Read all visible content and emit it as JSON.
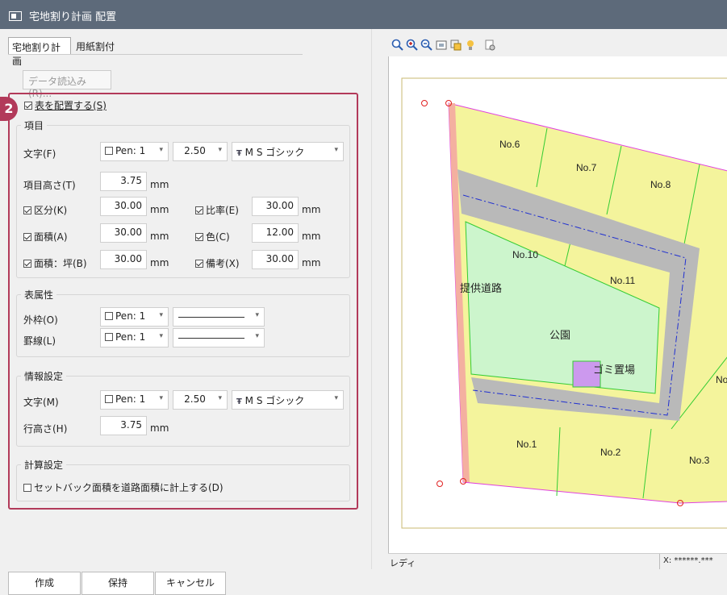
{
  "window": {
    "title": "宅地割り計画 配置"
  },
  "tabs": [
    {
      "label": "宅地割り計画"
    },
    {
      "label": "用紙割付"
    }
  ],
  "data_button": "データ読込み(R)...",
  "step_badge": "2",
  "place_table": {
    "label": "表を配置する(S)",
    "checked": true
  },
  "items_group": {
    "title": "項目",
    "text_label": "文字(F)",
    "text_pen": "Pen: 1",
    "text_size": "2.50",
    "text_font": "M S ゴシック",
    "height_label": "項目高さ(T)",
    "height_value": "3.75",
    "unit": "mm",
    "rows": [
      {
        "left_label": "区分(K)",
        "left_value": "30.00",
        "right_label": "比率(E)",
        "right_value": "30.00"
      },
      {
        "left_label": "面積(A)",
        "left_value": "30.00",
        "right_label": "色(C)",
        "right_value": "12.00"
      },
      {
        "left_label": "面積：坪(B)",
        "left_value": "30.00",
        "right_label": "備考(X)",
        "right_value": "30.00"
      }
    ]
  },
  "table_attr_group": {
    "title": "表属性",
    "outer_label": "外枠(O)",
    "outer_pen": "Pen: 1",
    "rule_label": "罫線(L)",
    "rule_pen": "Pen: 1"
  },
  "info_group": {
    "title": "情報設定",
    "text_label": "文字(M)",
    "text_pen": "Pen: 1",
    "text_size": "2.50",
    "text_font": "M S ゴシック",
    "line_height_label": "行高さ(H)",
    "line_height_value": "3.75",
    "unit": "mm"
  },
  "calc_group": {
    "title": "計算設定",
    "setback_label": "セットバック面積を道路面積に計上する(D)",
    "checked": false
  },
  "map_labels": {
    "lot6": "No.6",
    "lot7": "No.7",
    "lot8": "No.8",
    "lot10": "No.10",
    "lot11": "No.11",
    "road": "提供道路",
    "park": "公園",
    "garbage": "ゴミ置場",
    "lot1": "No.1",
    "lot2": "No.2",
    "lot3": "No.3",
    "lot_no": "No"
  },
  "status": {
    "left": "レディ",
    "coords": "X: ******.***"
  },
  "buttons": {
    "create": "作成",
    "keep": "保持",
    "cancel": "キャンセル"
  },
  "colors": {
    "accent": "#b23a5a",
    "lot_fill": "#f4f49c",
    "road_fill": "#b9b9b9",
    "park_fill": "#ccf5cc",
    "garbage_fill": "#cc99ee"
  }
}
